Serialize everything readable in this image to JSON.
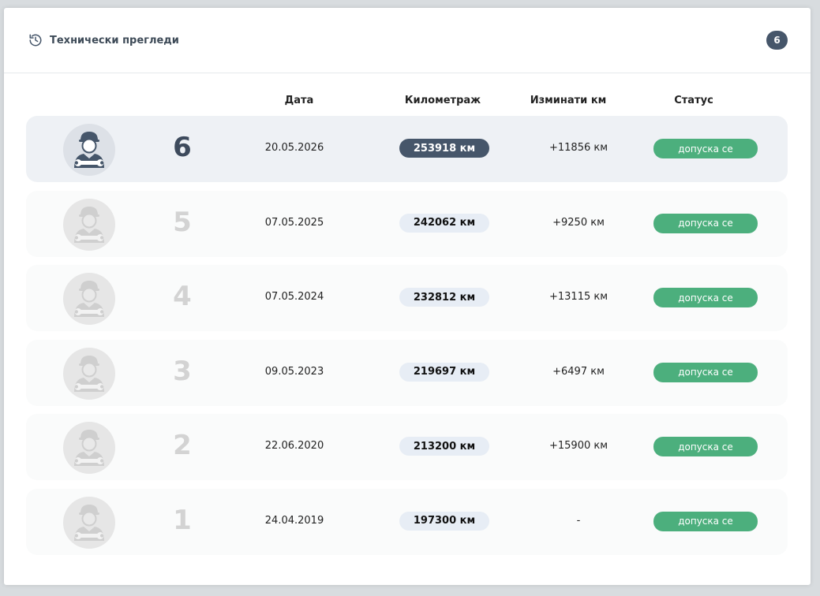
{
  "panel": {
    "title": "Технически прегледи",
    "count": "6",
    "header_icon": "history-icon"
  },
  "columns": {
    "date": "Дата",
    "mileage": "Километраж",
    "passed_km": "Изминати км",
    "status": "Статус"
  },
  "colors": {
    "active_row": "#eef1f5",
    "dark_accent": "#46566a",
    "status_green": "#4caf7d",
    "pill_light": "#e7edf5"
  },
  "inspections": [
    {
      "number": "6",
      "date": "20.05.2026",
      "mileage": "253918 км",
      "passed": "+11856 км",
      "status": "допуска се",
      "active": true
    },
    {
      "number": "5",
      "date": "07.05.2025",
      "mileage": "242062 км",
      "passed": "+9250 км",
      "status": "допуска се",
      "active": false
    },
    {
      "number": "4",
      "date": "07.05.2024",
      "mileage": "232812 км",
      "passed": "+13115 км",
      "status": "допуска се",
      "active": false
    },
    {
      "number": "3",
      "date": "09.05.2023",
      "mileage": "219697 км",
      "passed": "+6497 км",
      "status": "допуска се",
      "active": false
    },
    {
      "number": "2",
      "date": "22.06.2020",
      "mileage": "213200 км",
      "passed": "+15900 км",
      "status": "допуска се",
      "active": false
    },
    {
      "number": "1",
      "date": "24.04.2019",
      "mileage": "197300 км",
      "passed": "-",
      "status": "допуска се",
      "active": false
    }
  ]
}
